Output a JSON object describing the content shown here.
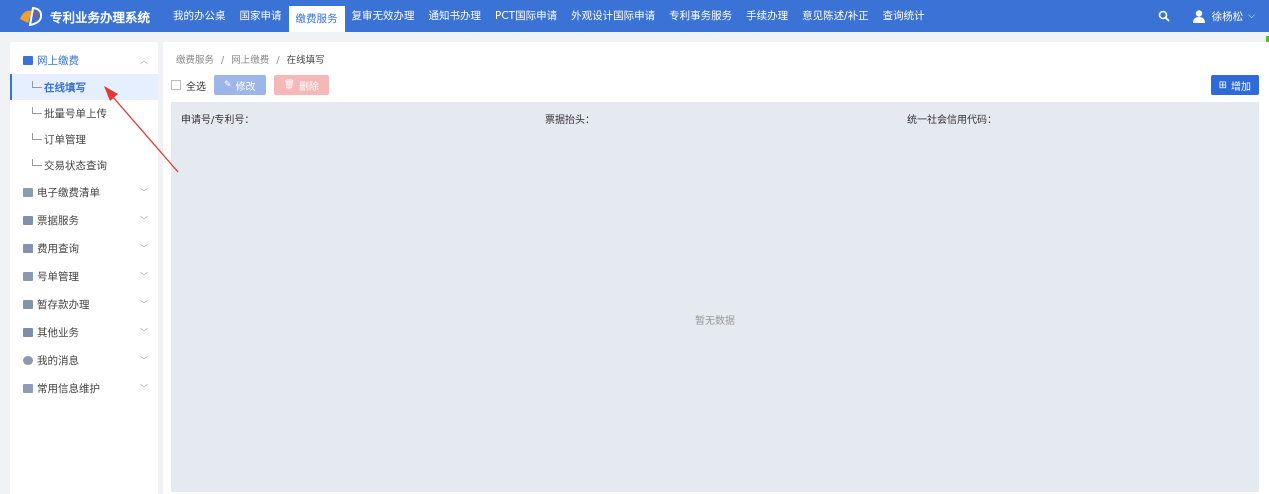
{
  "app": {
    "title": "专利业务办理系统"
  },
  "nav": {
    "items": [
      "我的办公桌",
      "国家申请",
      "缴费服务",
      "复审无效办理",
      "通知书办理",
      "PCT国际申请",
      "外观设计国际申请",
      "专利事务服务",
      "手续办理",
      "意见陈述/补正",
      "查询统计"
    ],
    "active": "缴费服务"
  },
  "user": {
    "name": "徐杨松"
  },
  "sidebar": {
    "open_group": {
      "label": "网上缴费",
      "icon": "wallet-icon"
    },
    "sub_items": [
      "在线填写",
      "批量号单上传",
      "订单管理",
      "交易状态查询"
    ],
    "active_sub": "在线填写",
    "groups": [
      {
        "label": "电子缴费清单",
        "icon": "list-icon"
      },
      {
        "label": "票据服务",
        "icon": "receipt-icon"
      },
      {
        "label": "费用查询",
        "icon": "search-doc-icon"
      },
      {
        "label": "号单管理",
        "icon": "number-list-icon"
      },
      {
        "label": "暂存款办理",
        "icon": "deposit-icon"
      },
      {
        "label": "其他业务",
        "icon": "other-icon"
      },
      {
        "label": "我的消息",
        "icon": "message-icon"
      },
      {
        "label": "常用信息维护",
        "icon": "edit-info-icon"
      }
    ]
  },
  "main": {
    "breadcrumb": [
      "缴费服务",
      "网上缴费",
      "在线填写"
    ],
    "breadcrumb_sep": "/",
    "select_all_label": "全选",
    "edit_label": "修改",
    "delete_label": "删除",
    "add_label": "增加",
    "fields": [
      "申请号/专利号：",
      "票据抬头：",
      "统一社会信用代码："
    ],
    "empty_text": "暂无数据"
  },
  "colors": {
    "primary": "#3a72d6",
    "annotation_arrow": "#e53935"
  }
}
